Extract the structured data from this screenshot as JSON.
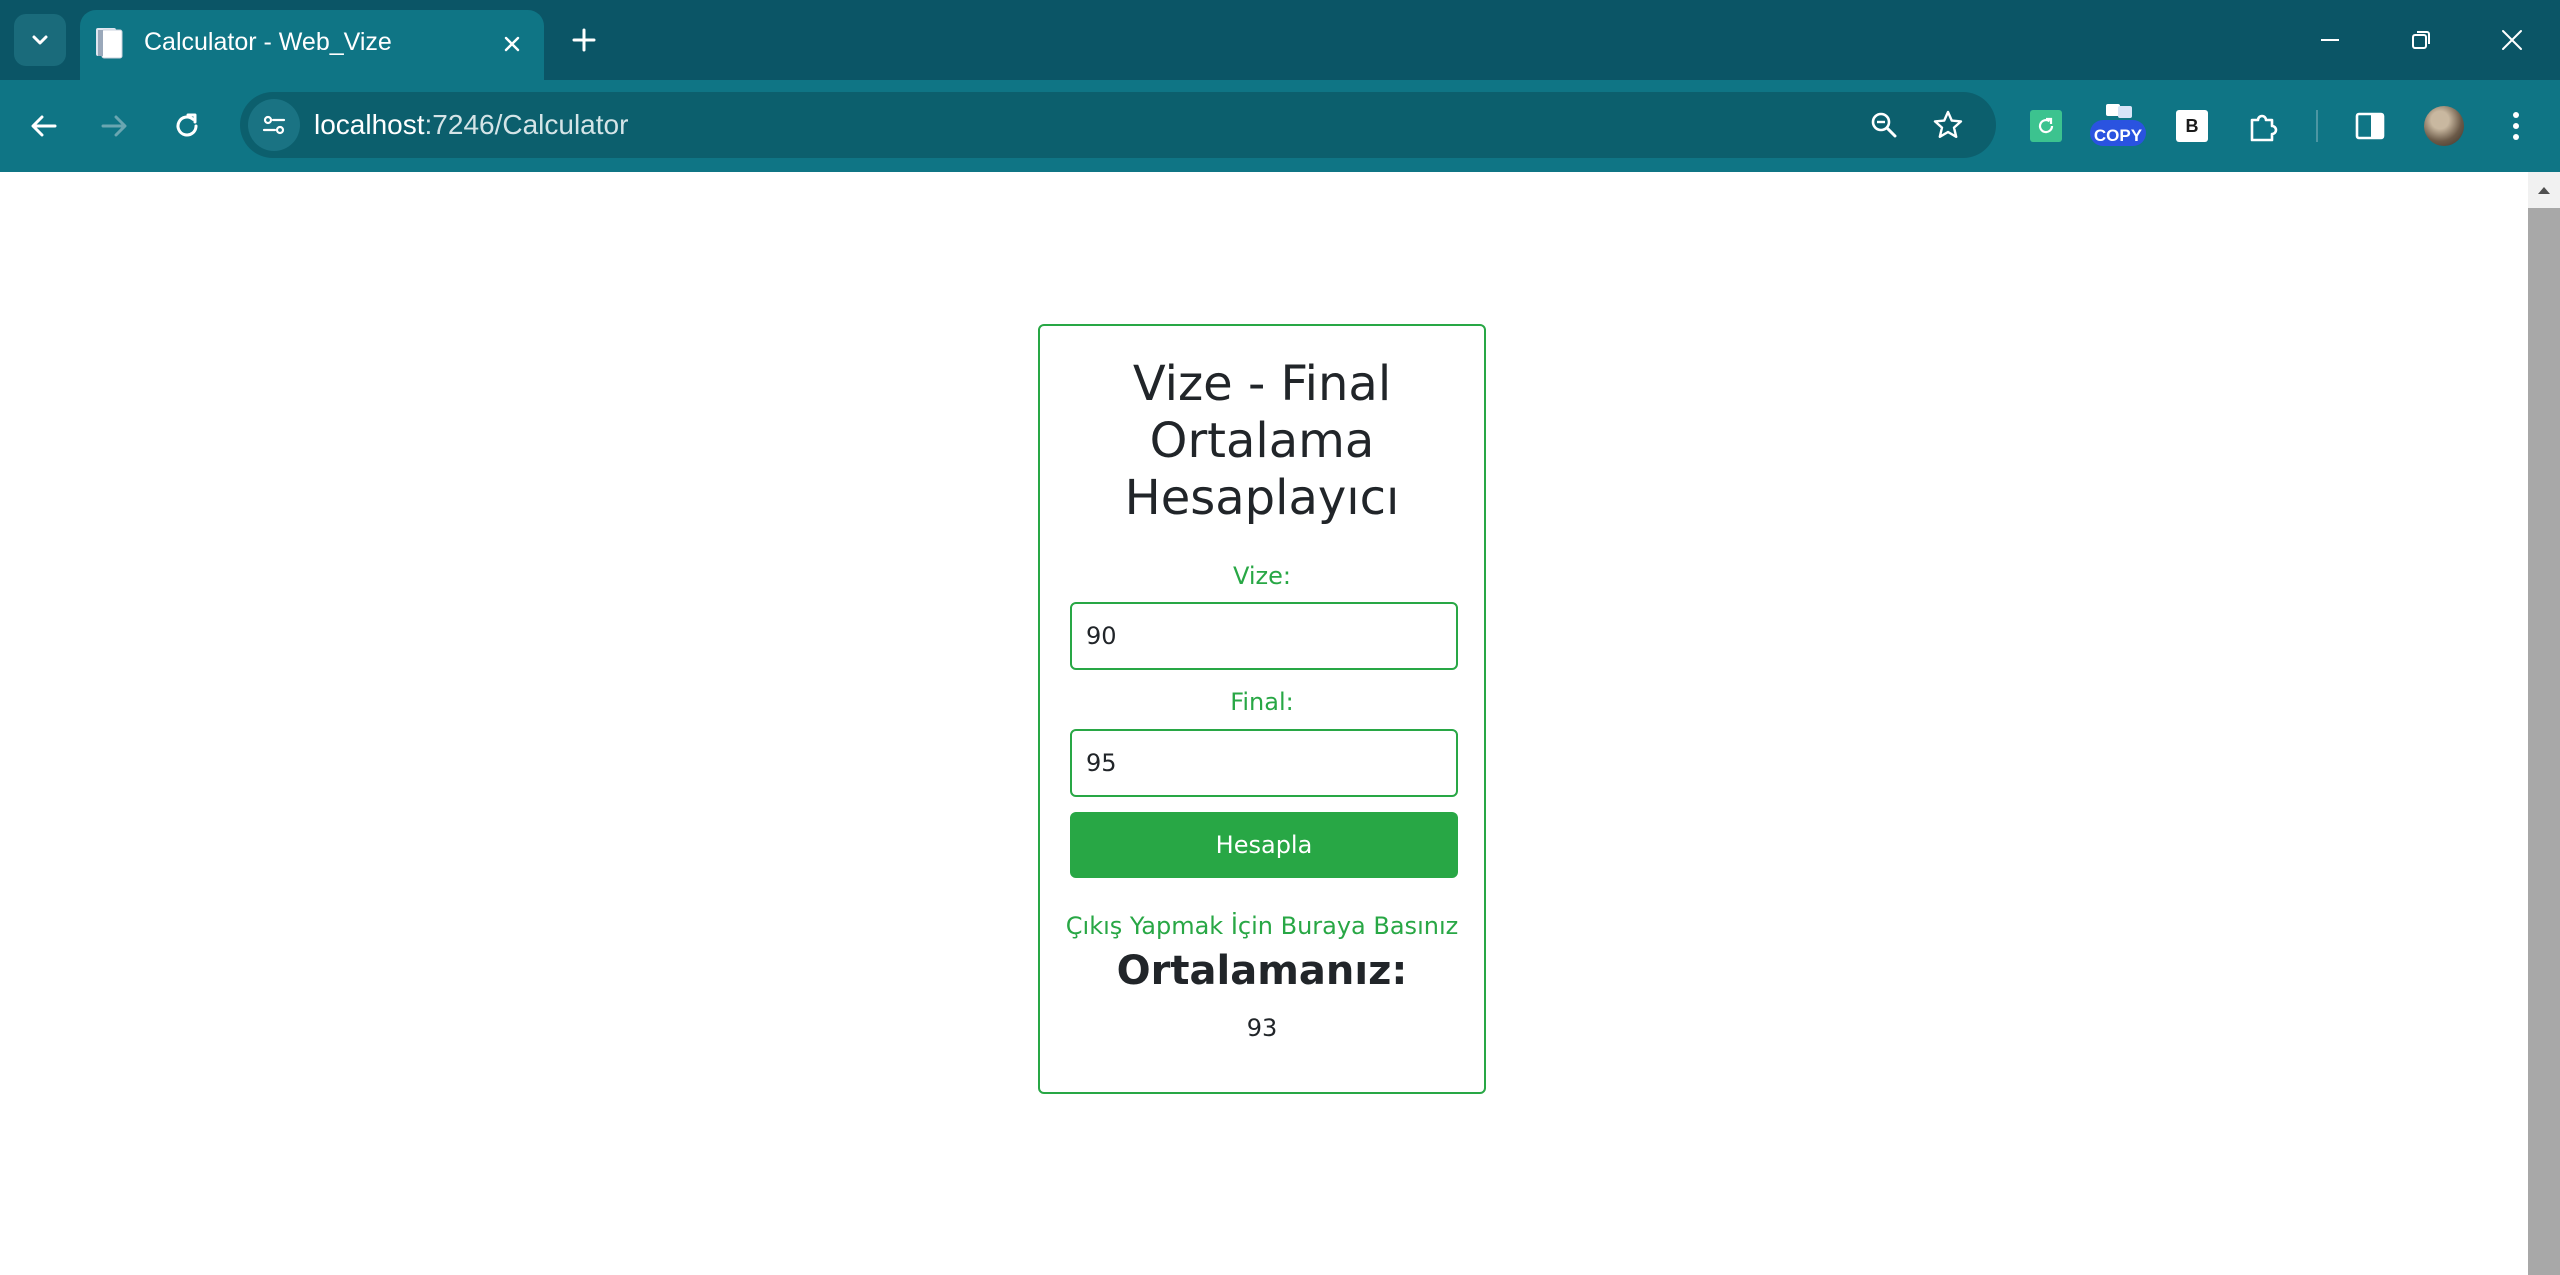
{
  "browser": {
    "tab": {
      "title": "Calculator - Web_Vize"
    },
    "address_bar": {
      "host": "localhost",
      "path": ":7246/Calculator"
    },
    "extensions": {
      "copy_badge": "COPY",
      "b_ext": "B"
    }
  },
  "page": {
    "title_lines": [
      "Vize - Final",
      "Ortalama",
      "Hesaplayıcı"
    ],
    "vize": {
      "label": "Vize:",
      "value": "90"
    },
    "final": {
      "label": "Final:",
      "value": "95"
    },
    "submit_label": "Hesapla",
    "logout_link": "Çıkış Yapmak İçin Buraya Basınız",
    "result_heading": "Ortalamanız:",
    "result_value": "93"
  },
  "colors": {
    "tabbar": "#0b5566",
    "toolbar": "#0f7585",
    "accent_green": "#28a745",
    "text_dark": "#212529"
  },
  "icons": [
    "tab-search-icon",
    "page-favicon",
    "close-icon",
    "plus-icon",
    "minimize-icon",
    "restore-icon",
    "close-window-icon",
    "back-arrow-icon",
    "forward-arrow-icon",
    "reload-icon",
    "site-settings-icon",
    "zoom-icon",
    "star-icon",
    "refresh-extension-icon",
    "copy-extension-icon",
    "b-extension-icon",
    "puzzle-icon",
    "side-panel-icon",
    "kebab-menu-icon"
  ]
}
